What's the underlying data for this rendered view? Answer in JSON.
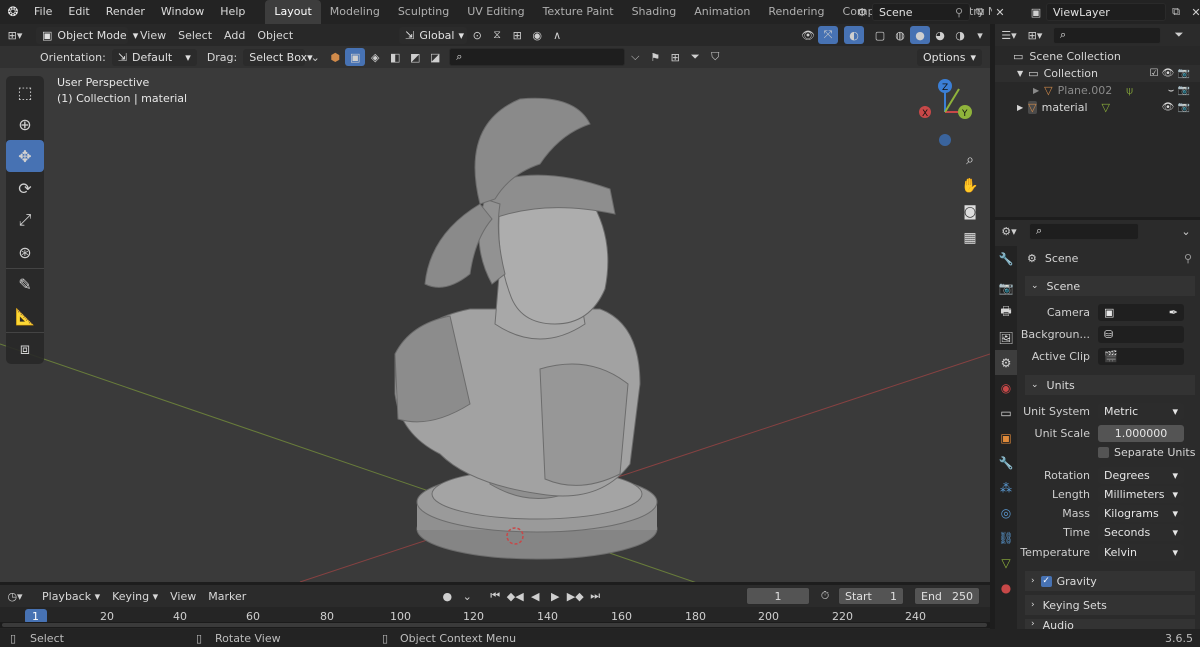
{
  "topbar": {
    "menus": [
      "File",
      "Edit",
      "Render",
      "Window",
      "Help"
    ],
    "workspaces": [
      "Layout",
      "Modeling",
      "Sculpting",
      "UV Editing",
      "Texture Paint",
      "Shading",
      "Animation",
      "Rendering",
      "Compositing",
      "Geometry Noc"
    ],
    "active_workspace": "Layout",
    "scene_name": "Scene",
    "view_layer": "ViewLayer"
  },
  "viewport_header": {
    "mode": "Object Mode",
    "menus": [
      "View",
      "Select",
      "Add",
      "Object"
    ],
    "transform_orientation": "Global"
  },
  "tool_header": {
    "orientation_label": "Orientation:",
    "orientation_value": "Default",
    "drag_label": "Drag:",
    "drag_value": "Select Box",
    "options_label": "Options"
  },
  "viewport": {
    "perspective": "User Perspective",
    "collection_info": "(1) Collection | material",
    "gizmo_axes": [
      "Z",
      "Y",
      "X"
    ]
  },
  "toolbar": {
    "tools": [
      "select-box",
      "cursor",
      "move",
      "rotate",
      "scale",
      "transform",
      "annotate",
      "measure",
      "add-cube"
    ],
    "active": "move"
  },
  "outliner": {
    "root": "Scene Collection",
    "items": [
      {
        "name": "Collection",
        "level": 1
      },
      {
        "name": "Plane.002",
        "level": 2
      },
      {
        "name": "material",
        "level": 1
      }
    ]
  },
  "properties": {
    "context": "Scene",
    "scene_section": "Scene",
    "camera_label": "Camera",
    "background_label": "Backgroun...",
    "active_clip_label": "Active Clip",
    "units_section": "Units",
    "unit_system_label": "Unit System",
    "unit_system_value": "Metric",
    "unit_scale_label": "Unit Scale",
    "unit_scale_value": "1.000000",
    "separate_units": "Separate Units",
    "rotation_label": "Rotation",
    "rotation_value": "Degrees",
    "length_label": "Length",
    "length_value": "Millimeters",
    "mass_label": "Mass",
    "mass_value": "Kilograms",
    "time_label": "Time",
    "time_value": "Seconds",
    "temperature_label": "Temperature",
    "temperature_value": "Kelvin",
    "gravity_label": "Gravity",
    "keying_sets_label": "Keying Sets",
    "audio_label": "Audio"
  },
  "timeline": {
    "menus": [
      "Playback",
      "Keying",
      "View",
      "Marker"
    ],
    "current_frame": "1",
    "start_label": "Start",
    "start_value": "1",
    "end_label": "End",
    "end_value": "250",
    "ticks": [
      "1",
      "20",
      "40",
      "60",
      "80",
      "100",
      "120",
      "140",
      "160",
      "180",
      "200",
      "220",
      "240"
    ]
  },
  "statusbar": {
    "select": "Select",
    "rotate_view": "Rotate View",
    "context_menu": "Object Context Menu",
    "version": "3.6.5"
  },
  "colors": {
    "accent": "#4772b3",
    "viewport_bg": "#3a3a3a",
    "x_axis": "#c74848",
    "y_axis": "#8fb33b",
    "z_axis": "#3b7fd6"
  }
}
